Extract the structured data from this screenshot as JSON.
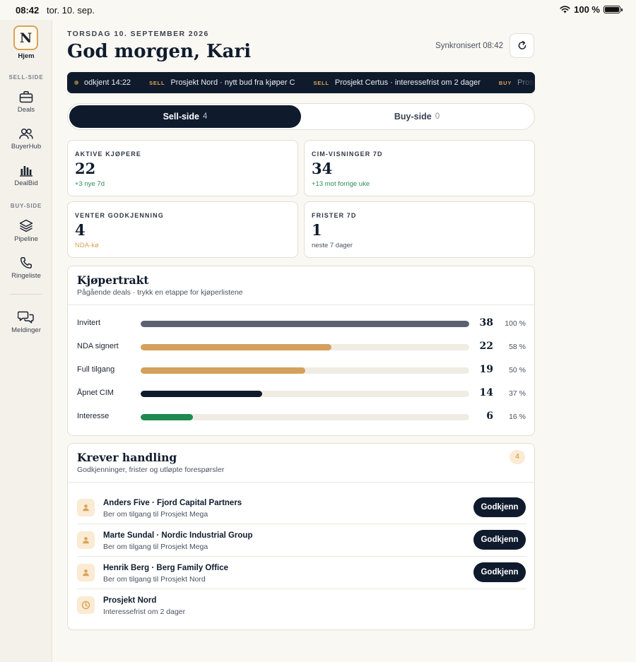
{
  "status_bar": {
    "time": "08:42",
    "date": "tor. 10. sep.",
    "battery": "100 %"
  },
  "sidebar": {
    "logo": "N",
    "home_label": "Hjem",
    "sell_side_label": "SELL-SIDE",
    "buy_side_label": "BUY-SIDE",
    "items": [
      {
        "label": "Deals",
        "icon": "briefcase-icon"
      },
      {
        "label": "BuyerHub",
        "icon": "users-icon"
      },
      {
        "label": "DealBid",
        "icon": "bar-chart-icon"
      },
      {
        "label": "Pipeline",
        "icon": "layers-icon"
      },
      {
        "label": "Ringeliste",
        "icon": "phone-icon"
      },
      {
        "label": "Meldinger",
        "icon": "chat-icon"
      }
    ]
  },
  "header": {
    "date": "TORSDAG 10. SEPTEMBER 2026",
    "greeting": "God morgen, Kari",
    "sync": "Synkronisert 08:42"
  },
  "ticker": [
    {
      "tag": "",
      "text": "odkjent 14:22",
      "dot": true
    },
    {
      "tag": "SELL",
      "text": "Prosjekt Nord · nytt bud fra kjøper C"
    },
    {
      "tag": "SELL",
      "text": "Prosjekt Certus · interessefrist om 2 dager"
    },
    {
      "tag": "BUY",
      "text": "Pros"
    }
  ],
  "tabs": [
    {
      "label": "Sell-side",
      "count": "4"
    },
    {
      "label": "Buy-side",
      "count": "0"
    }
  ],
  "kpis": [
    {
      "label": "AKTIVE KJØPERE",
      "value": "22",
      "sub": "+3 nye 7d",
      "sub_color": "#2E8B57"
    },
    {
      "label": "CIM-VISNINGER 7D",
      "value": "34",
      "sub": "+13 mot forrige uke",
      "sub_color": "#2E8B57"
    },
    {
      "label": "VENTER GODKJENNING",
      "value": "4",
      "sub": "NDA-kø",
      "sub_color": "#D9A35A"
    },
    {
      "label": "FRISTER 7D",
      "value": "1",
      "sub": "neste 7 dager",
      "sub_color": "#4A5260"
    }
  ],
  "funnel": {
    "title": "Kjøpertrakt",
    "subtitle": "Pågående deals · trykk en etappe for kjøperlistene",
    "stages": [
      {
        "label": "Invitert",
        "count": "38",
        "pct_label": "100 %",
        "fraction": 1.0,
        "color": "#5A6170"
      },
      {
        "label": "NDA signert",
        "count": "22",
        "pct_label": "58 %",
        "fraction": 0.58,
        "color": "#D4A05C"
      },
      {
        "label": "Full tilgang",
        "count": "19",
        "pct_label": "50 %",
        "fraction": 0.5,
        "color": "#D4A05C"
      },
      {
        "label": "Åpnet CIM",
        "count": "14",
        "pct_label": "37 %",
        "fraction": 0.37,
        "color": "#0F1B2D"
      },
      {
        "label": "Interesse",
        "count": "6",
        "pct_label": "16 %",
        "fraction": 0.16,
        "color": "#1E8A52"
      }
    ]
  },
  "actions": {
    "title": "Krever handling",
    "subtitle": "Godkjenninger, frister og utløpte forespørsler",
    "badge": "4",
    "approve_label": "Godkjenn",
    "items": [
      {
        "name": "Anders Five · Fjord Capital Partners",
        "desc": "Ber om tilgang til Prosjekt Mega",
        "icon": "person-icon"
      },
      {
        "name": "Marte Sundal · Nordic Industrial Group",
        "desc": "Ber om tilgang til Prosjekt Mega",
        "icon": "person-icon"
      },
      {
        "name": "Henrik Berg · Berg Family Office",
        "desc": "Ber om tilgang til Prosjekt Nord",
        "icon": "person-icon"
      },
      {
        "name": "Prosjekt Nord",
        "desc": "Interessefrist om 2 dager",
        "icon": "clock-icon"
      }
    ]
  },
  "colors": {
    "navy": "#0F1B2D",
    "accent": "#D9A35A",
    "positive": "#2E8B57",
    "background": "#FAF8F3"
  }
}
